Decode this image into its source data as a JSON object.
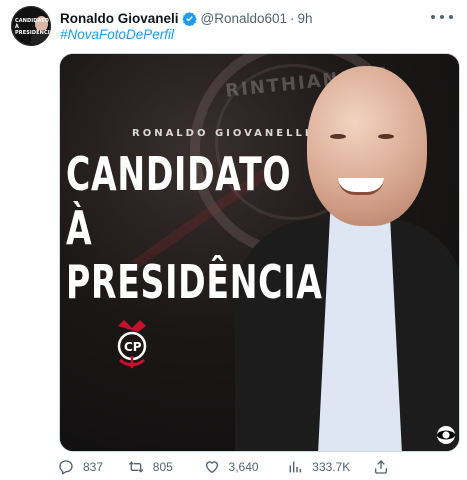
{
  "author": {
    "name": "Ronaldo Giovaneli",
    "handle": "@Ronaldo601",
    "separator": "·",
    "time": "9h",
    "avatar_text": "CANDIDATO À PRESIDÊNCIA"
  },
  "tweet": {
    "hashtag": "#NovaFotoDePerfil"
  },
  "media": {
    "crest_text": "RINTHIANS PA",
    "subtitle": "RONALDO GIOVANELLI",
    "headline_line1": "CANDIDATO À",
    "headline_line2": "PRESIDÊNCIA"
  },
  "actions": {
    "replies": "837",
    "retweets": "805",
    "likes": "3,640",
    "views": "333.7K"
  },
  "colors": {
    "accent": "#1d9bf0",
    "muted": "#536471",
    "corinthians_red": "#c8102e"
  },
  "icons": [
    "verified-badge-icon",
    "more-options-icon",
    "reply-icon",
    "retweet-icon",
    "like-icon",
    "views-icon",
    "share-icon",
    "club-logo-icon",
    "broadcaster-logo-icon"
  ]
}
